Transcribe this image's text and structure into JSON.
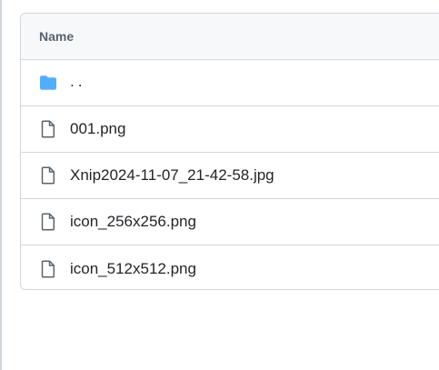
{
  "table": {
    "header": "Name",
    "rows": [
      {
        "name": "..",
        "icon": "folder-icon"
      },
      {
        "name": "001.png",
        "icon": "file-icon"
      },
      {
        "name": "Xnip2024-11-07_21-42-58.jpg",
        "icon": "file-icon"
      },
      {
        "name": "icon_256x256.png",
        "icon": "file-icon"
      },
      {
        "name": "icon_512x512.png",
        "icon": "file-icon"
      }
    ]
  },
  "colors": {
    "folder": "#54aeff",
    "file_icon": "#59636e",
    "border": "#d0d7de",
    "header_bg": "#f6f8fa",
    "text": "#1f2328"
  }
}
